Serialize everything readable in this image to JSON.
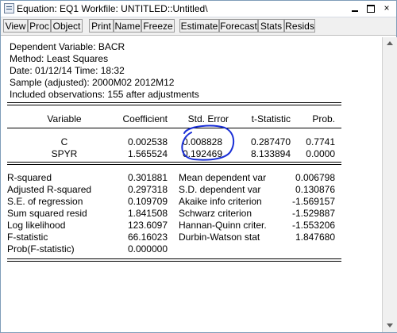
{
  "window": {
    "title": "Equation: EQ1   Workfile: UNTITLED::Untitled\\",
    "minimize": "",
    "maximize": "",
    "close": "×"
  },
  "toolbar": {
    "buttons": [
      "View",
      "Proc",
      "Object",
      "Print",
      "Name",
      "Freeze",
      "Estimate",
      "Forecast",
      "Stats",
      "Resids"
    ]
  },
  "output": {
    "header_lines": [
      "Dependent Variable: BACR",
      "Method: Least Squares",
      "Date: 01/12/14   Time: 18:32",
      "Sample (adjusted): 2000M02 2012M12",
      "Included observations: 155 after adjustments"
    ],
    "coef_headers": [
      "Variable",
      "Coefficient",
      "Std. Error",
      "t-Statistic",
      "Prob."
    ],
    "coef_rows": [
      [
        "C",
        "0.002538",
        "0.008828",
        "0.287470",
        "0.7741"
      ],
      [
        "SPYR",
        "1.565524",
        "0.192469",
        "8.133894",
        "0.0000"
      ]
    ],
    "stats_rows": [
      [
        "R-squared",
        "0.301881",
        "Mean dependent var",
        "0.006798"
      ],
      [
        "Adjusted R-squared",
        "0.297318",
        "S.D. dependent var",
        "0.130876"
      ],
      [
        "S.E. of regression",
        "0.109709",
        "Akaike info criterion",
        "-1.569157"
      ],
      [
        "Sum squared resid",
        "1.841508",
        "Schwarz criterion",
        "-1.529887"
      ],
      [
        "Log likelihood",
        "123.6097",
        "Hannan-Quinn criter.",
        "-1.553206"
      ],
      [
        "F-statistic",
        "66.16023",
        "Durbin-Watson stat",
        "1.847680"
      ],
      [
        "Prob(F-statistic)",
        "0.000000",
        "",
        ""
      ]
    ]
  },
  "colors": {
    "annotation": "#1a2fd6",
    "toolbar_bg": "#f0f0f0"
  }
}
